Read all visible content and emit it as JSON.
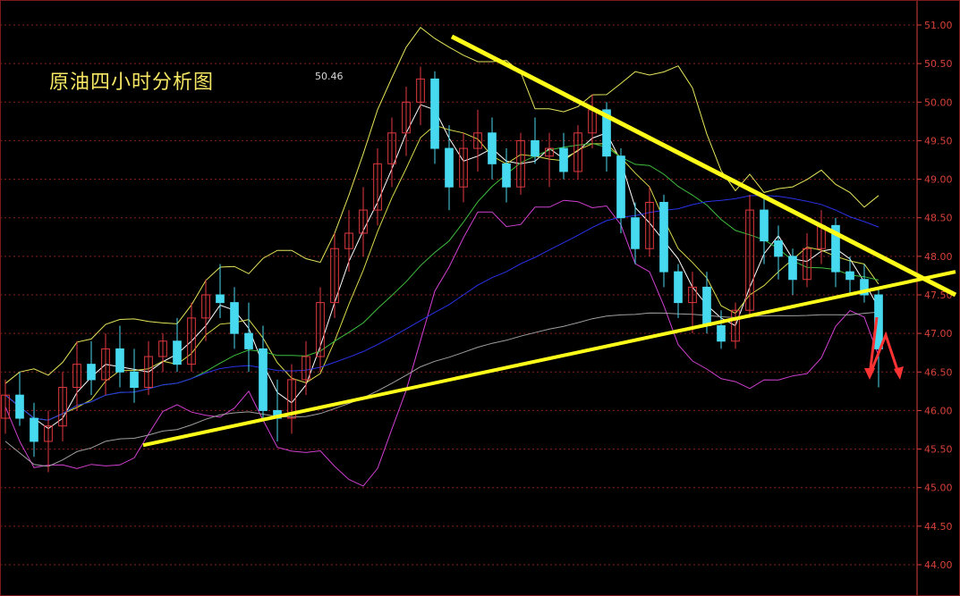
{
  "chart_data": {
    "type": "candlestick",
    "title": "原油四小时分析图",
    "annotations": [
      {
        "text": "50.46",
        "value": 50.46
      }
    ],
    "y_ticks": [
      "51.00",
      "50.50",
      "50.00",
      "49.50",
      "49.00",
      "48.50",
      "48.00",
      "47.50",
      "47.00",
      "46.50",
      "46.00",
      "45.50",
      "45.00",
      "44.50",
      "44.00"
    ],
    "ylim": [
      43.6,
      51.35
    ],
    "grid": true,
    "colors": {
      "background": "#000000",
      "up": "#e0393f",
      "down": "#46d9f0",
      "ma_short": "#ffffff",
      "ma_mid": "#d9d94a",
      "ma_green": "#3fbf3f",
      "ma_blue": "#2832e6",
      "ma_long": "#a0a0a0",
      "bb_upper": "#e6e65a",
      "bb_lower": "#d040d0",
      "trendline": "#ffff1a",
      "arrow": "#ff3333",
      "axis": "#d8413a"
    },
    "candles": [
      [
        45.9,
        46.4,
        45.7,
        46.2
      ],
      [
        46.2,
        46.5,
        45.8,
        45.9
      ],
      [
        45.9,
        46.1,
        45.4,
        45.6
      ],
      [
        45.6,
        46.0,
        45.2,
        45.8
      ],
      [
        45.8,
        46.5,
        45.6,
        46.3
      ],
      [
        46.3,
        46.9,
        46.0,
        46.6
      ],
      [
        46.6,
        46.9,
        46.2,
        46.4
      ],
      [
        46.4,
        47.0,
        46.2,
        46.8
      ],
      [
        46.8,
        47.1,
        46.3,
        46.5
      ],
      [
        46.5,
        46.8,
        46.1,
        46.3
      ],
      [
        46.3,
        46.9,
        46.2,
        46.7
      ],
      [
        46.7,
        47.0,
        46.5,
        46.9
      ],
      [
        46.9,
        47.2,
        46.5,
        46.6
      ],
      [
        46.6,
        47.4,
        46.5,
        47.2
      ],
      [
        47.2,
        47.7,
        46.9,
        47.5
      ],
      [
        47.5,
        47.9,
        47.2,
        47.4
      ],
      [
        47.4,
        47.6,
        46.8,
        47.0
      ],
      [
        47.0,
        47.4,
        46.5,
        46.8
      ],
      [
        46.8,
        47.1,
        45.9,
        46.0
      ],
      [
        46.0,
        46.4,
        45.6,
        45.9
      ],
      [
        45.9,
        46.6,
        45.7,
        46.4
      ],
      [
        46.4,
        46.9,
        46.2,
        46.7
      ],
      [
        46.7,
        47.6,
        46.5,
        47.4
      ],
      [
        47.4,
        48.3,
        47.2,
        48.1
      ],
      [
        48.1,
        48.6,
        47.8,
        48.3
      ],
      [
        48.3,
        48.9,
        48.0,
        48.6
      ],
      [
        48.6,
        49.4,
        48.4,
        49.2
      ],
      [
        49.2,
        49.8,
        48.9,
        49.6
      ],
      [
        49.6,
        50.2,
        49.3,
        50.0
      ],
      [
        50.0,
        50.46,
        49.7,
        50.3
      ],
      [
        50.3,
        50.4,
        49.2,
        49.4
      ],
      [
        49.4,
        49.7,
        48.6,
        48.9
      ],
      [
        48.9,
        49.6,
        48.7,
        49.4
      ],
      [
        49.4,
        49.9,
        49.1,
        49.6
      ],
      [
        49.6,
        49.8,
        49.0,
        49.2
      ],
      [
        49.2,
        49.4,
        48.7,
        48.9
      ],
      [
        48.9,
        49.6,
        48.8,
        49.5
      ],
      [
        49.5,
        49.8,
        49.2,
        49.3
      ],
      [
        49.3,
        49.6,
        48.9,
        49.4
      ],
      [
        49.4,
        49.6,
        49.0,
        49.1
      ],
      [
        49.1,
        49.7,
        49.0,
        49.6
      ],
      [
        49.6,
        50.1,
        49.4,
        49.9
      ],
      [
        49.9,
        50.0,
        49.1,
        49.3
      ],
      [
        49.3,
        49.4,
        48.3,
        48.5
      ],
      [
        48.5,
        48.7,
        47.9,
        48.1
      ],
      [
        48.1,
        48.9,
        48.0,
        48.7
      ],
      [
        48.7,
        48.8,
        47.6,
        47.8
      ],
      [
        47.8,
        47.9,
        47.2,
        47.4
      ],
      [
        47.4,
        47.8,
        47.0,
        47.6
      ],
      [
        47.6,
        47.8,
        47.0,
        47.1
      ],
      [
        47.1,
        47.3,
        46.8,
        46.9
      ],
      [
        46.9,
        47.4,
        46.8,
        47.3
      ],
      [
        47.3,
        48.8,
        47.2,
        48.6
      ],
      [
        48.6,
        48.8,
        47.9,
        48.2
      ],
      [
        48.2,
        48.4,
        47.7,
        48.0
      ],
      [
        48.0,
        48.1,
        47.5,
        47.7
      ],
      [
        47.7,
        48.3,
        47.6,
        48.1
      ],
      [
        48.1,
        48.6,
        47.9,
        48.4
      ],
      [
        48.4,
        48.5,
        47.6,
        47.8
      ],
      [
        47.8,
        48.0,
        47.5,
        47.7
      ],
      [
        47.7,
        47.9,
        47.4,
        47.5
      ],
      [
        47.5,
        47.6,
        46.3,
        46.8
      ]
    ],
    "trendlines": [
      {
        "from": [
          0,
          50.85
        ],
        "to": [
          1,
          47.5
        ]
      },
      {
        "from": [
          0,
          45.55
        ],
        "to": [
          1,
          47.8
        ]
      }
    ]
  }
}
